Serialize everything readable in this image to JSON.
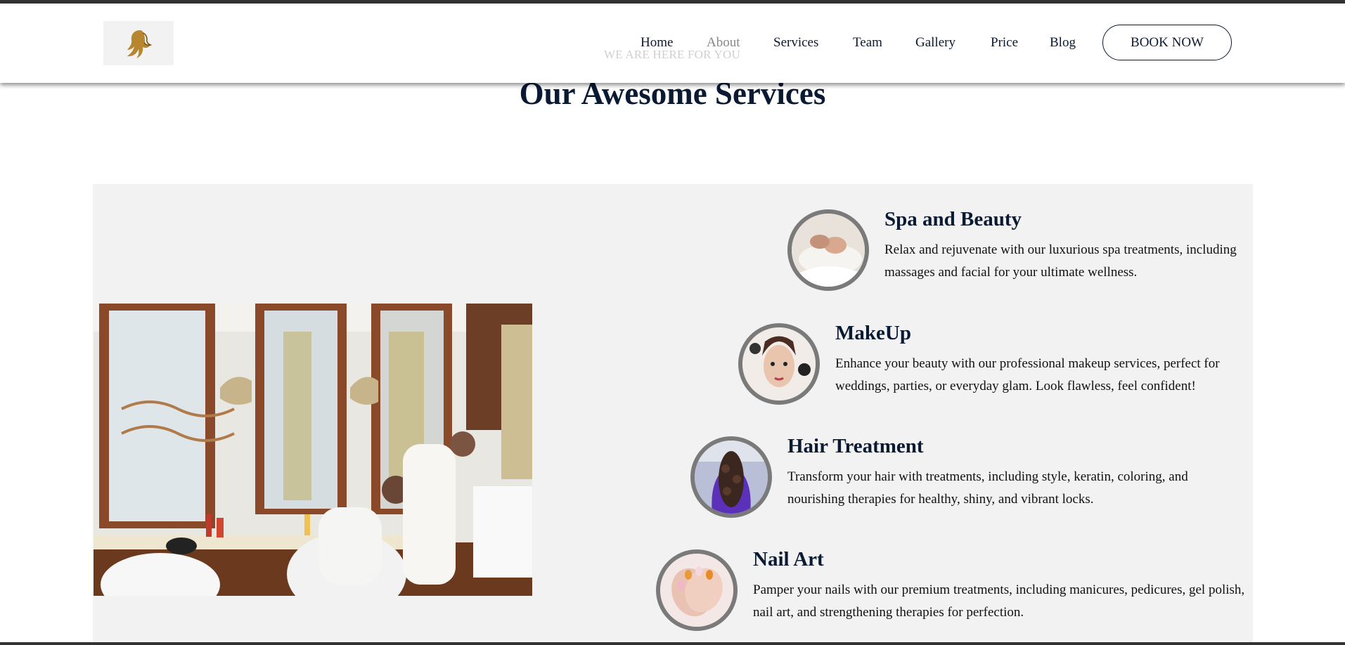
{
  "header": {
    "tagline": "WE ARE HERE FOR YOU",
    "nav": [
      {
        "label": "Home",
        "active": false
      },
      {
        "label": "About",
        "active": true
      },
      {
        "label": "Services",
        "active": false
      },
      {
        "label": "Team",
        "active": false
      },
      {
        "label": "Gallery",
        "active": false
      },
      {
        "label": "Price",
        "active": false
      },
      {
        "label": "Blog",
        "active": false
      }
    ],
    "cta_label": "BOOK NOW",
    "logo_icon": "woman-silhouette-logo"
  },
  "section": {
    "title": "Our Awesome Services"
  },
  "services": [
    {
      "title": "Spa and Beauty",
      "description": "Relax and rejuvenate with our luxurious spa treatments, including massages and facial for your ultimate wellness.",
      "image": "spa-image"
    },
    {
      "title": "MakeUp",
      "description": "Enhance your beauty with our professional makeup services, perfect for weddings, parties, or everyday glam. Look flawless, feel confident!",
      "image": "makeup-image"
    },
    {
      "title": "Hair Treatment",
      "description": "Transform your hair with treatments, including style, keratin, coloring, and nourishing therapies for healthy, shiny, and vibrant locks.",
      "image": "hair-image"
    },
    {
      "title": "Nail Art",
      "description": "Pamper your nails with our premium treatments, including manicures, pedicures, gel polish, nail art, and strengthening therapies for perfection.",
      "image": "nail-image"
    }
  ],
  "colors": {
    "heading": "#0a1a33",
    "panel_bg": "#f2f2f2",
    "nav_active": "#888888",
    "thumb_border": "#7a7a7a"
  }
}
